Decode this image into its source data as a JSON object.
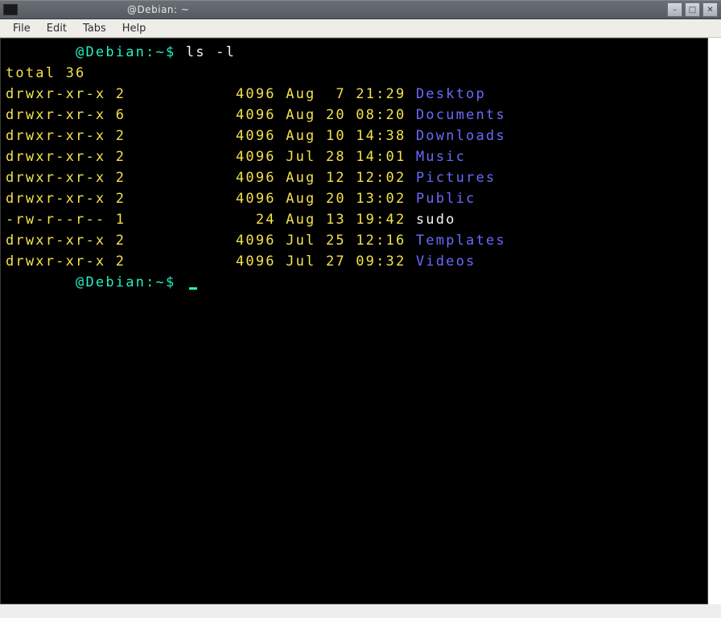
{
  "window": {
    "title": "@Debian: ~"
  },
  "menubar": {
    "items": [
      "File",
      "Edit",
      "Tabs",
      "Help"
    ]
  },
  "prompt": {
    "host": "@Debian:",
    "path": "~",
    "symbol": "$"
  },
  "command": "ls -l",
  "output": {
    "total_line": "total 36",
    "entries": [
      {
        "perms": "drwxr-xr-x",
        "links": "2",
        "size": "4096",
        "month": "Aug",
        "day": " 7",
        "time": "21:29",
        "name": "Desktop",
        "is_dir": true
      },
      {
        "perms": "drwxr-xr-x",
        "links": "6",
        "size": "4096",
        "month": "Aug",
        "day": "20",
        "time": "08:20",
        "name": "Documents",
        "is_dir": true
      },
      {
        "perms": "drwxr-xr-x",
        "links": "2",
        "size": "4096",
        "month": "Aug",
        "day": "10",
        "time": "14:38",
        "name": "Downloads",
        "is_dir": true
      },
      {
        "perms": "drwxr-xr-x",
        "links": "2",
        "size": "4096",
        "month": "Jul",
        "day": "28",
        "time": "14:01",
        "name": "Music",
        "is_dir": true
      },
      {
        "perms": "drwxr-xr-x",
        "links": "2",
        "size": "4096",
        "month": "Aug",
        "day": "12",
        "time": "12:02",
        "name": "Pictures",
        "is_dir": true
      },
      {
        "perms": "drwxr-xr-x",
        "links": "2",
        "size": "4096",
        "month": "Aug",
        "day": "20",
        "time": "13:02",
        "name": "Public",
        "is_dir": true
      },
      {
        "perms": "-rw-r--r--",
        "links": "1",
        "size": "24",
        "month": "Aug",
        "day": "13",
        "time": "19:42",
        "name": "sudo",
        "is_dir": false
      },
      {
        "perms": "drwxr-xr-x",
        "links": "2",
        "size": "4096",
        "month": "Jul",
        "day": "25",
        "time": "12:16",
        "name": "Templates",
        "is_dir": true
      },
      {
        "perms": "drwxr-xr-x",
        "links": "2",
        "size": "4096",
        "month": "Jul",
        "day": "27",
        "time": "09:32",
        "name": "Videos",
        "is_dir": true
      }
    ]
  },
  "colors": {
    "prompt": "#24f0c2",
    "listing": "#f3e24c",
    "dir": "#6a6aff",
    "file": "#f5f5f5",
    "bg": "#000000"
  }
}
